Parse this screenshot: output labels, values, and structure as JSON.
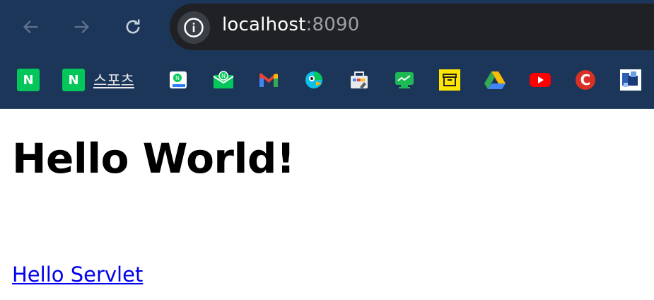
{
  "browser": {
    "url_host": "localhost",
    "url_port": ":8090",
    "colors": {
      "toolbar": "#1c3659",
      "omnibox": "#202124"
    },
    "nav": [
      {
        "name": "back-icon"
      },
      {
        "name": "forward-icon"
      },
      {
        "name": "reload-icon"
      }
    ],
    "site_info_icon": "info-icon"
  },
  "bookmarks": [
    {
      "icon": "naver-icon",
      "label": ""
    },
    {
      "icon": "naver-icon",
      "label": "스포츠"
    },
    {
      "icon": "naver-map-icon",
      "label": ""
    },
    {
      "icon": "naver-mail-icon",
      "label": ""
    },
    {
      "icon": "gmail-icon",
      "label": ""
    },
    {
      "icon": "papago-icon",
      "label": ""
    },
    {
      "icon": "webstore-icon",
      "label": ""
    },
    {
      "icon": "green-screen-icon",
      "label": ""
    },
    {
      "icon": "yellow-box-icon",
      "label": ""
    },
    {
      "icon": "google-drive-icon",
      "label": ""
    },
    {
      "icon": "youtube-icon",
      "label": ""
    },
    {
      "icon": "red-c-icon",
      "label": ""
    },
    {
      "icon": "pixel-logo-icon",
      "label": ""
    }
  ],
  "page": {
    "heading": "Hello World!",
    "link_text": "Hello Servlet"
  }
}
